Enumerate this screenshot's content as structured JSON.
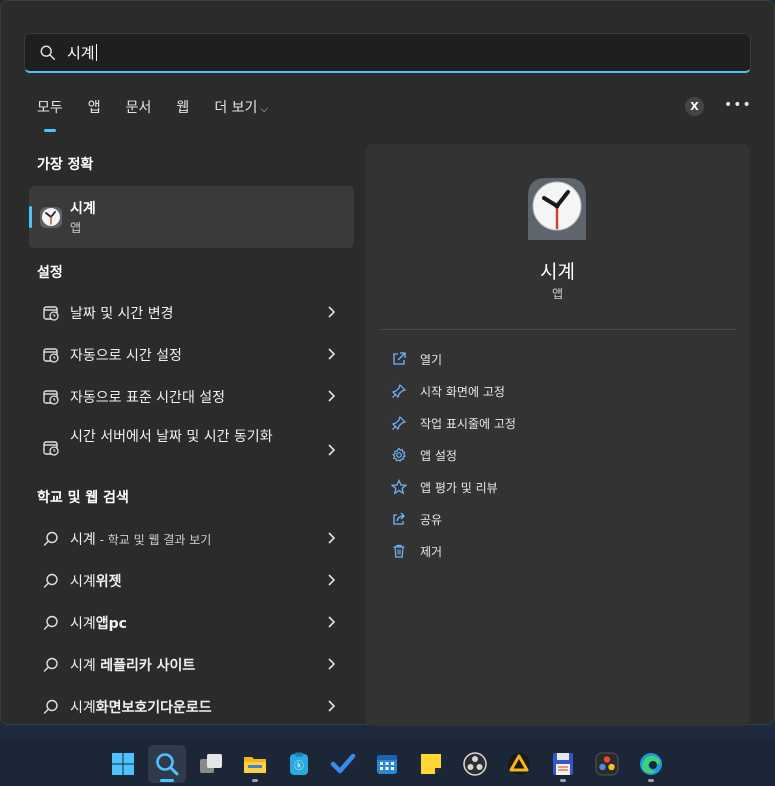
{
  "search": {
    "query": "시계"
  },
  "tabs": [
    {
      "label": "모두"
    },
    {
      "label": "앱"
    },
    {
      "label": "문서"
    },
    {
      "label": "웹"
    },
    {
      "label": "더 보기"
    }
  ],
  "header_buttons": {
    "close_label": "X",
    "more_label": "•••"
  },
  "sections": {
    "best_match": "가장 정확",
    "settings": "설정",
    "web": "학교 및 웹 검색"
  },
  "best_match": {
    "name": "시계",
    "kind": "앱"
  },
  "settings_items": [
    {
      "label": "날짜 및 시간 변경"
    },
    {
      "label": "자동으로 시간 설정"
    },
    {
      "label": "자동으로 표준 시간대 설정"
    },
    {
      "label": "시간 서버에서 날짜 및 시간 동기화"
    }
  ],
  "web_items": [
    {
      "prefix": "시계",
      "suffix": " - 학교 및 웹 결과 보기"
    },
    {
      "prefix": "시계",
      "bold": "위젯"
    },
    {
      "prefix": "시계",
      "bold": "앱pc"
    },
    {
      "prefix": "시계 ",
      "bold": "레플리카 사이트"
    },
    {
      "prefix": "시계",
      "bold": "화면보호기다운로드"
    }
  ],
  "preview": {
    "title": "시계",
    "subtitle": "앱",
    "actions": [
      {
        "label": "열기",
        "icon": "open-icon"
      },
      {
        "label": "시작 화면에 고정",
        "icon": "pin-icon"
      },
      {
        "label": "작업 표시줄에 고정",
        "icon": "pin-icon"
      },
      {
        "label": "앱 설정",
        "icon": "gear-icon"
      },
      {
        "label": "앱 평가 및 리뷰",
        "icon": "star-icon"
      },
      {
        "label": "공유",
        "icon": "share-icon"
      },
      {
        "label": "제거",
        "icon": "trash-icon"
      }
    ]
  },
  "taskbar": {
    "icons": [
      "windows-start-icon",
      "search-icon",
      "task-view-icon",
      "file-explorer-icon",
      "clipboard-app-icon",
      "todo-icon",
      "calendar-icon",
      "sticky-notes-icon",
      "obs-icon",
      "vlc-style-icon",
      "notepad-save-icon",
      "resolve-icon",
      "edge-icon"
    ]
  },
  "colors": {
    "accent": "#4cc2ff",
    "panel": "#2b2b2b",
    "preview": "#333333"
  }
}
